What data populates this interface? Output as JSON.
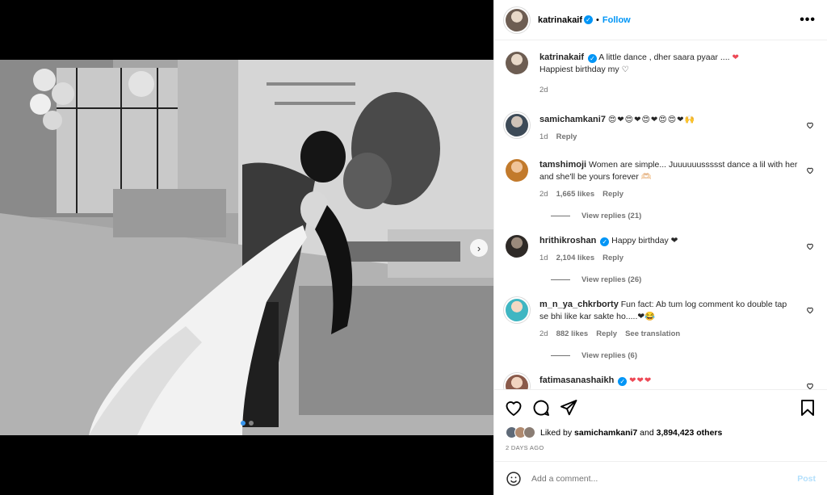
{
  "post": {
    "username": "katrinakaif",
    "follow_label": "Follow",
    "separator": "•",
    "more_label": "•••"
  },
  "caption": {
    "username": "katrinakaif",
    "text": "A little dance , dher saara pyaar ....",
    "line2": "Happiest birthday my",
    "time": "2d"
  },
  "comments": [
    {
      "username": "samichamkani7",
      "emojis": "😍❤😍❤😍❤😍😍❤🙌",
      "time": "1d",
      "reply": "Reply"
    },
    {
      "username": "tamshimoji",
      "text": "Women are simple... Juuuuuussssst dance a lil with her and she'll be yours forever 🫶🏻",
      "time": "2d",
      "likes": "1,665 likes",
      "reply": "Reply",
      "replies": "View replies (21)"
    },
    {
      "username": "hrithikroshan",
      "text": "Happy birthday ❤",
      "time": "1d",
      "likes": "2,104 likes",
      "reply": "Reply",
      "replies": "View replies (26)"
    },
    {
      "username": "m_n_ya_chkrborty",
      "text": "Fun fact: Ab tum log comment ko double tap se bhi like kar sakte ho.....❤😂",
      "time": "2d",
      "likes": "882 likes",
      "reply": "Reply",
      "translate": "See translation",
      "replies": "View replies (6)"
    },
    {
      "username": "fatimasanashaikh",
      "text": "❤❤❤"
    }
  ],
  "likes": {
    "prefix": "Liked by",
    "user": "samichamkani7",
    "and": "and",
    "others": "3,894,423 others"
  },
  "timestamp": "2 DAYS AGO",
  "add_comment": {
    "placeholder": "Add a comment...",
    "post_label": "Post"
  },
  "carousel": {
    "next_icon": "›",
    "total": 2,
    "current": 1
  }
}
